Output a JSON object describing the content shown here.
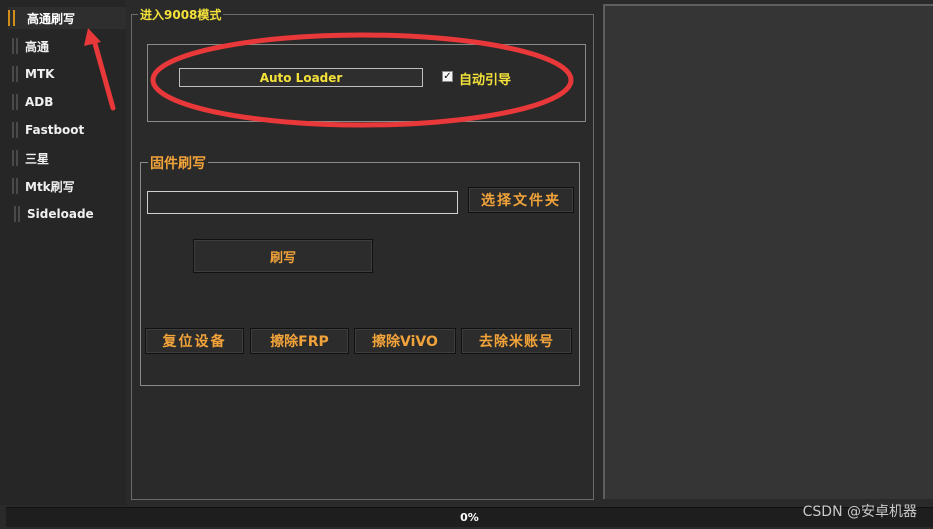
{
  "sidebar": {
    "items": [
      {
        "label": "高通刷写",
        "active": true
      },
      {
        "label": "高通"
      },
      {
        "label": "MTK"
      },
      {
        "label": "ADB"
      },
      {
        "label": "Fastboot"
      },
      {
        "label": "三星"
      },
      {
        "label": "Mtk刷写"
      },
      {
        "label": "Sideloade"
      }
    ]
  },
  "edl_section": {
    "title": "进入9008模式",
    "auto_loader_label": "Auto Loader",
    "auto_boot_label": "自动引导",
    "auto_boot_checked": true
  },
  "firmware_section": {
    "title": "固件刷写",
    "path_value": "",
    "select_folder_label": "选择文件夹",
    "flash_label": "刷写",
    "reset_label": "复位设备",
    "erase_frp_label": "擦除FRP",
    "erase_vivo_label": "擦除ViVO",
    "remove_mi_label": "去除米账号"
  },
  "progress": {
    "text": "0%",
    "value": 0
  },
  "watermark": "CSDN @安卓机器",
  "colors": {
    "accent": "#f2a33a",
    "yellow": "#f4e23a",
    "annotation": "#e8383a"
  }
}
